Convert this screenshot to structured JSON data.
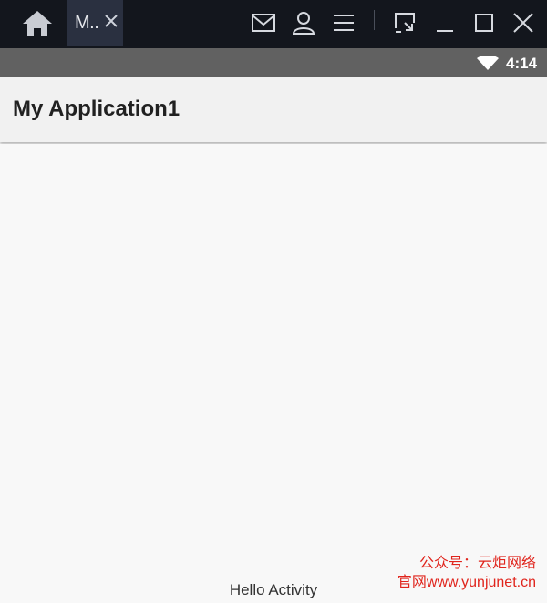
{
  "window": {
    "tab_label": "M..",
    "icons": [
      "home-icon",
      "close-icon",
      "mail-icon",
      "user-icon",
      "menu-icon",
      "screenshot-icon",
      "minimize-icon",
      "maximize-icon",
      "close-window-icon"
    ]
  },
  "status_bar": {
    "time": "4:14"
  },
  "app": {
    "title": "My Application1"
  },
  "content": {
    "message": "Hello Activity"
  },
  "watermark": {
    "line1": "公众号：云炬网络",
    "line2": "官网www.yunjunet.cn"
  },
  "colors": {
    "titlebar": "#13161d",
    "tab": "#2a3040",
    "status_bar": "#616161",
    "app_bar": "#f1f1f1",
    "background": "#f8f8f8",
    "watermark": "#e0241c"
  }
}
